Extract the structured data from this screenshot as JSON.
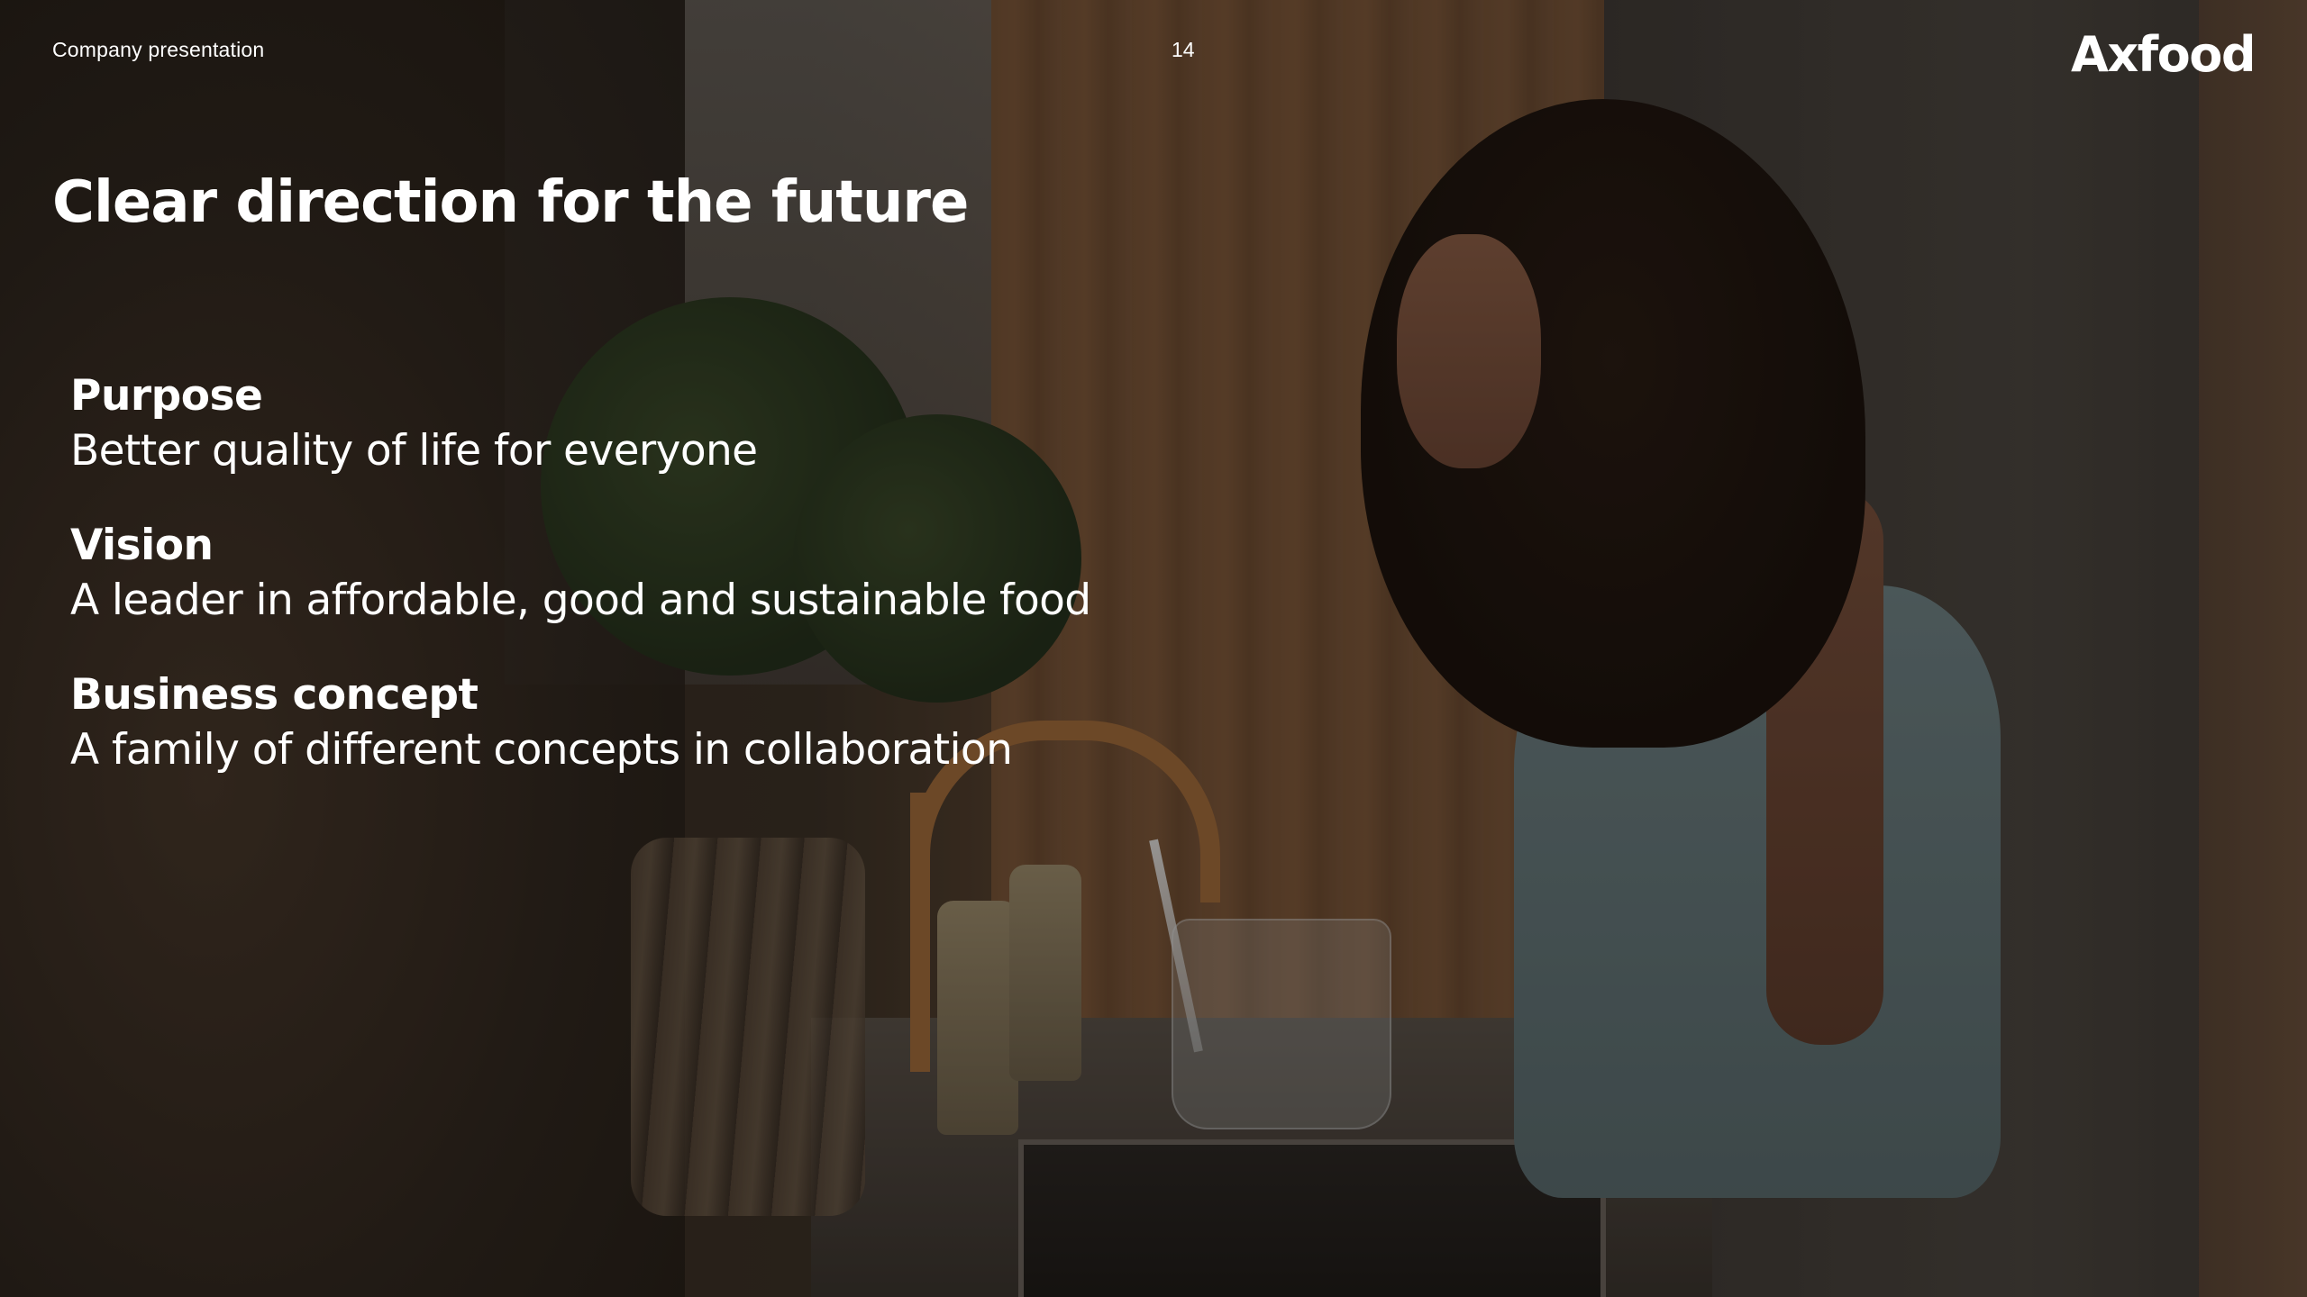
{
  "header": {
    "label": "Company presentation",
    "page_number": "14",
    "logo_text": "Axfood"
  },
  "title": "Clear direction for the future",
  "statements": [
    {
      "heading": "Purpose",
      "text": "Better quality of life for everyone"
    },
    {
      "heading": "Vision",
      "text": "A leader in affordable, good and sustainable food"
    },
    {
      "heading": "Business concept",
      "text": "A family of different concepts in collaboration"
    }
  ],
  "colors": {
    "text": "#ffffff"
  }
}
